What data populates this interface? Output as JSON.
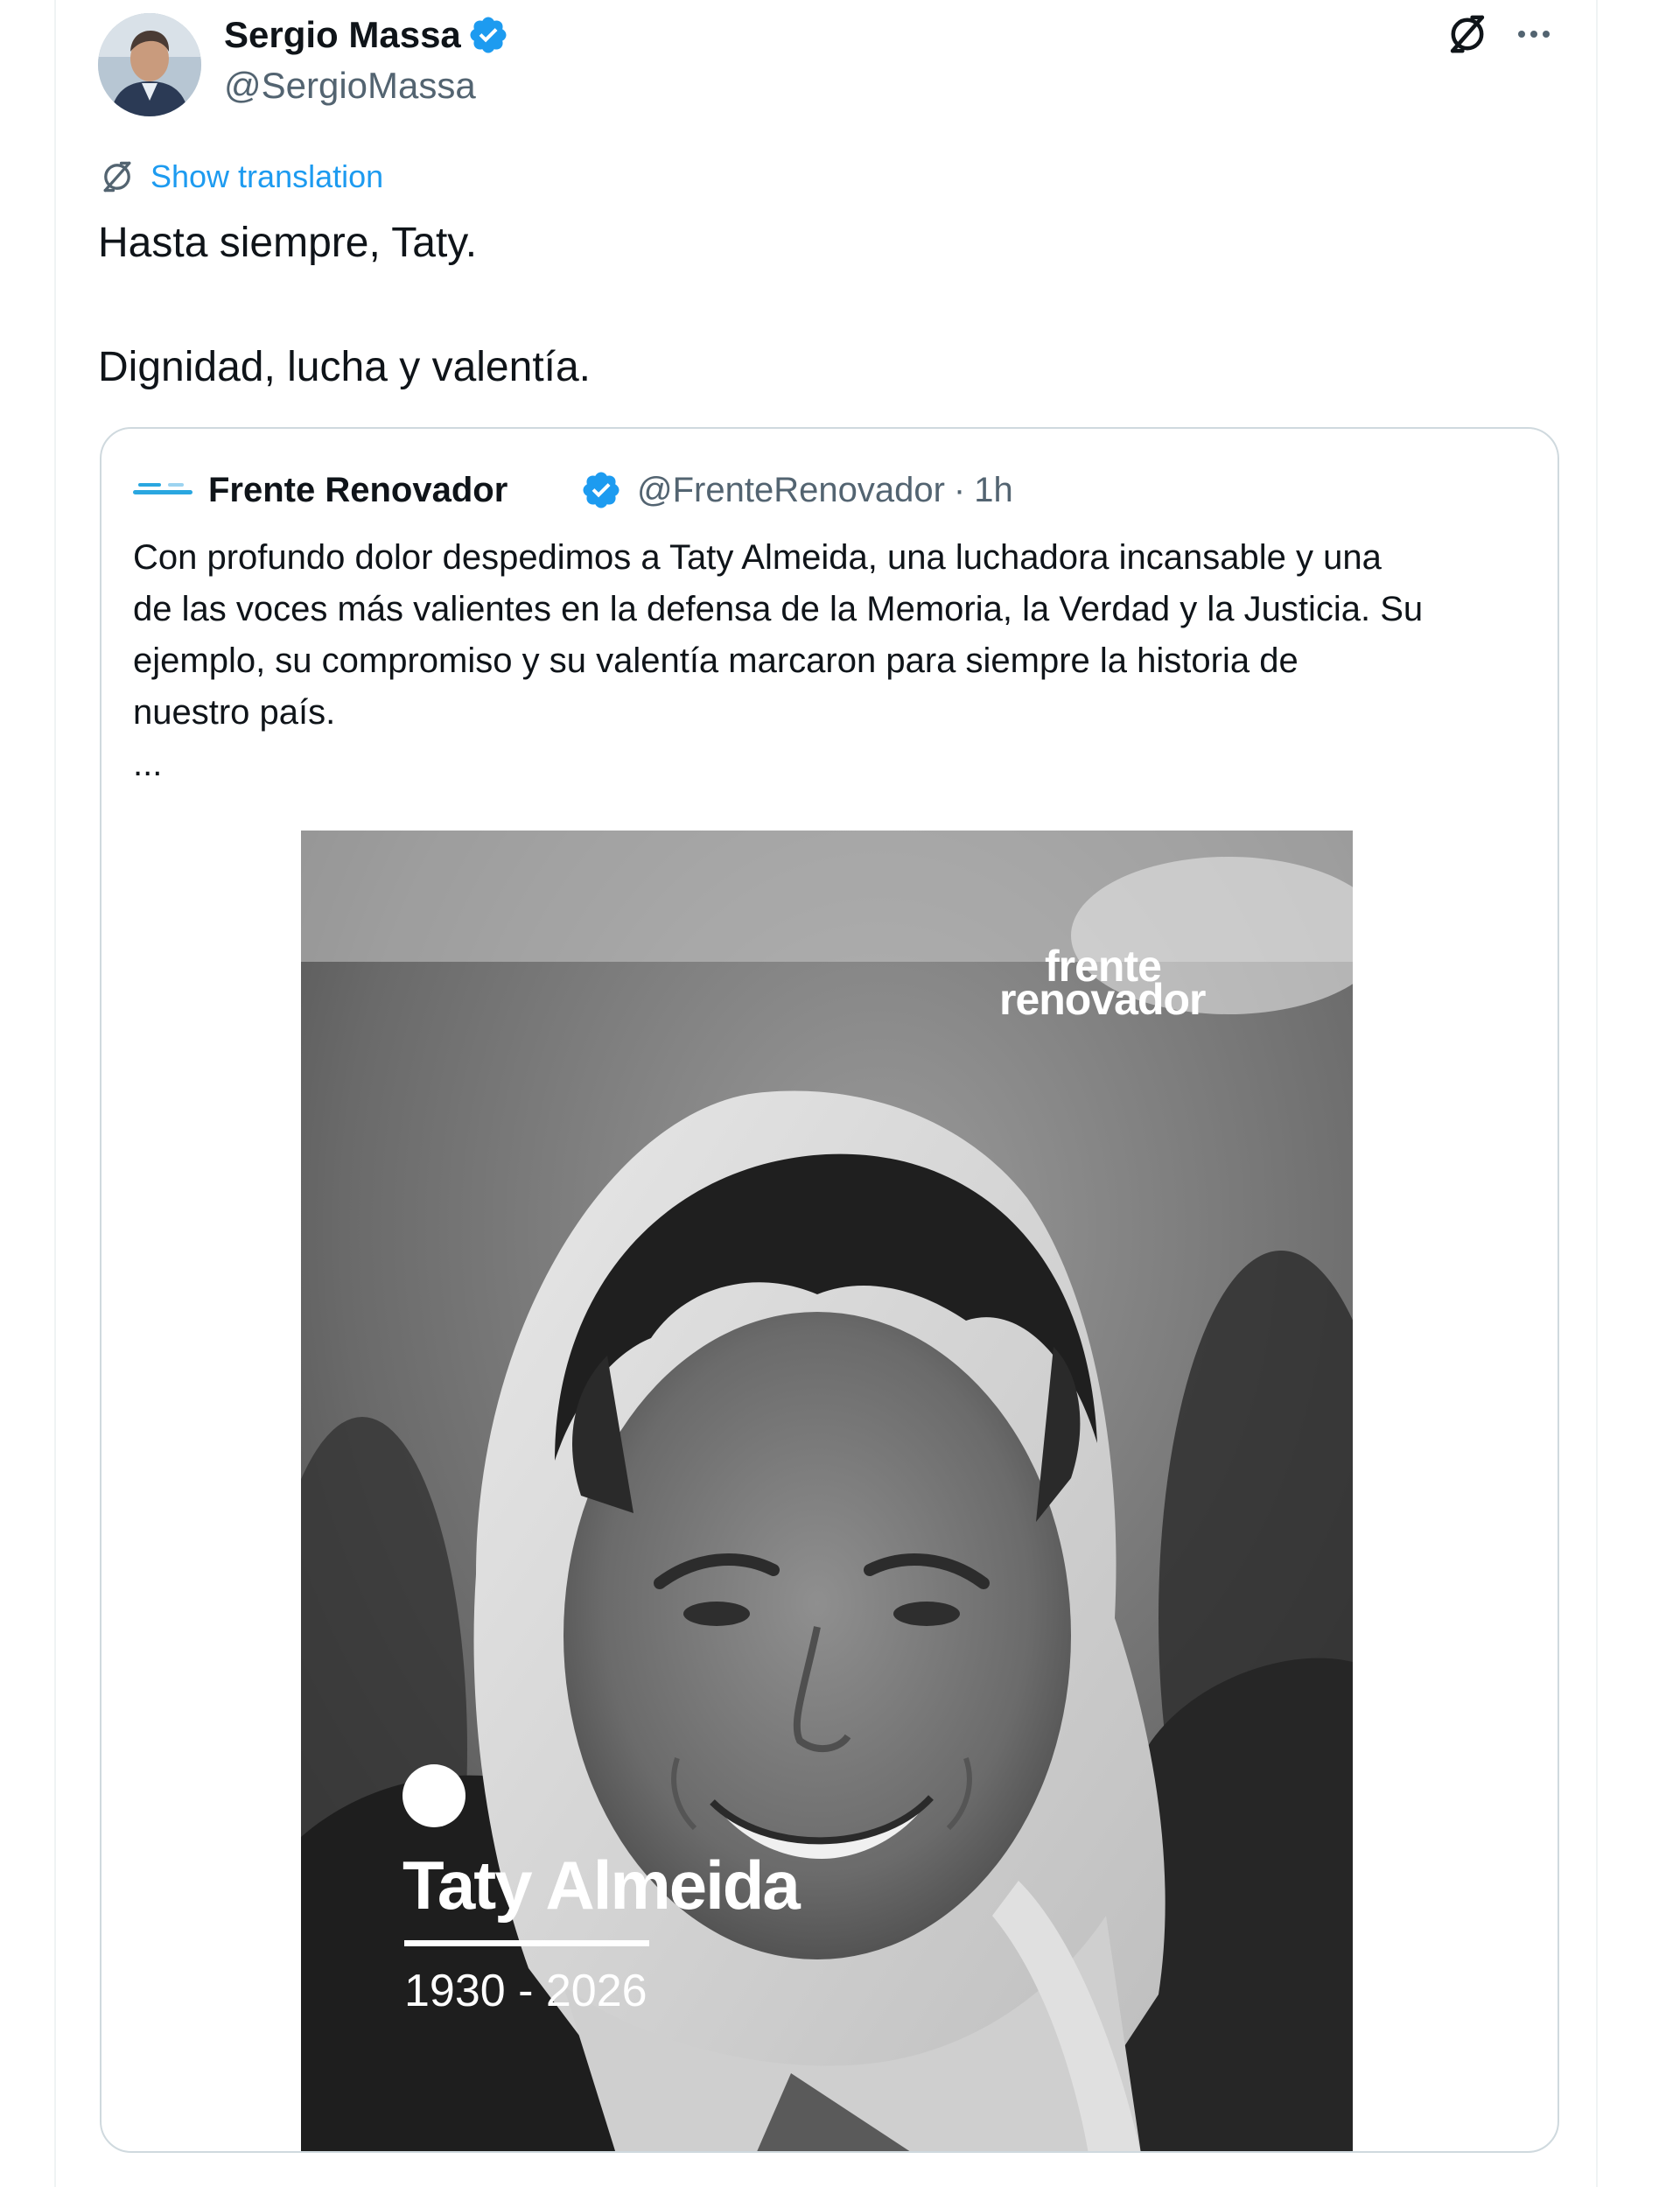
{
  "post": {
    "author_name": "Sergio Massa",
    "author_handle": "@SergioMassa",
    "translate_label": "Show translation",
    "text_line_1": "Hasta siempre, Taty.",
    "text_line_2": "Dignidad, lucha y valentía."
  },
  "icons": {
    "verified": "verified-badge-icon",
    "translate": "translate-icon",
    "more": "more-options-icon"
  },
  "quoted": {
    "author_name": "Frente Renovador",
    "author_handle": "@FrenteRenovador",
    "separator": "·",
    "time": "1h",
    "text_lines": [
      "Con profundo dolor despedimos a Taty Almeida, una luchadora incansable y una",
      "de las voces más valientes en la defensa de la Memoria, la Verdad y la Justicia. Su",
      "ejemplo, su compromiso y su valentía marcaron para siempre la historia de",
      "nuestro país."
    ],
    "ellipsis": "...",
    "media": {
      "watermark_line_1": "frente",
      "watermark_line_2": "renovador",
      "name": "Taty Almeida",
      "years": "1930 - 2026"
    }
  },
  "colors": {
    "accent": "#1d9bf0",
    "verified": "#1d9bf0",
    "secondary_text": "#536471",
    "border": "#cfd9de"
  }
}
